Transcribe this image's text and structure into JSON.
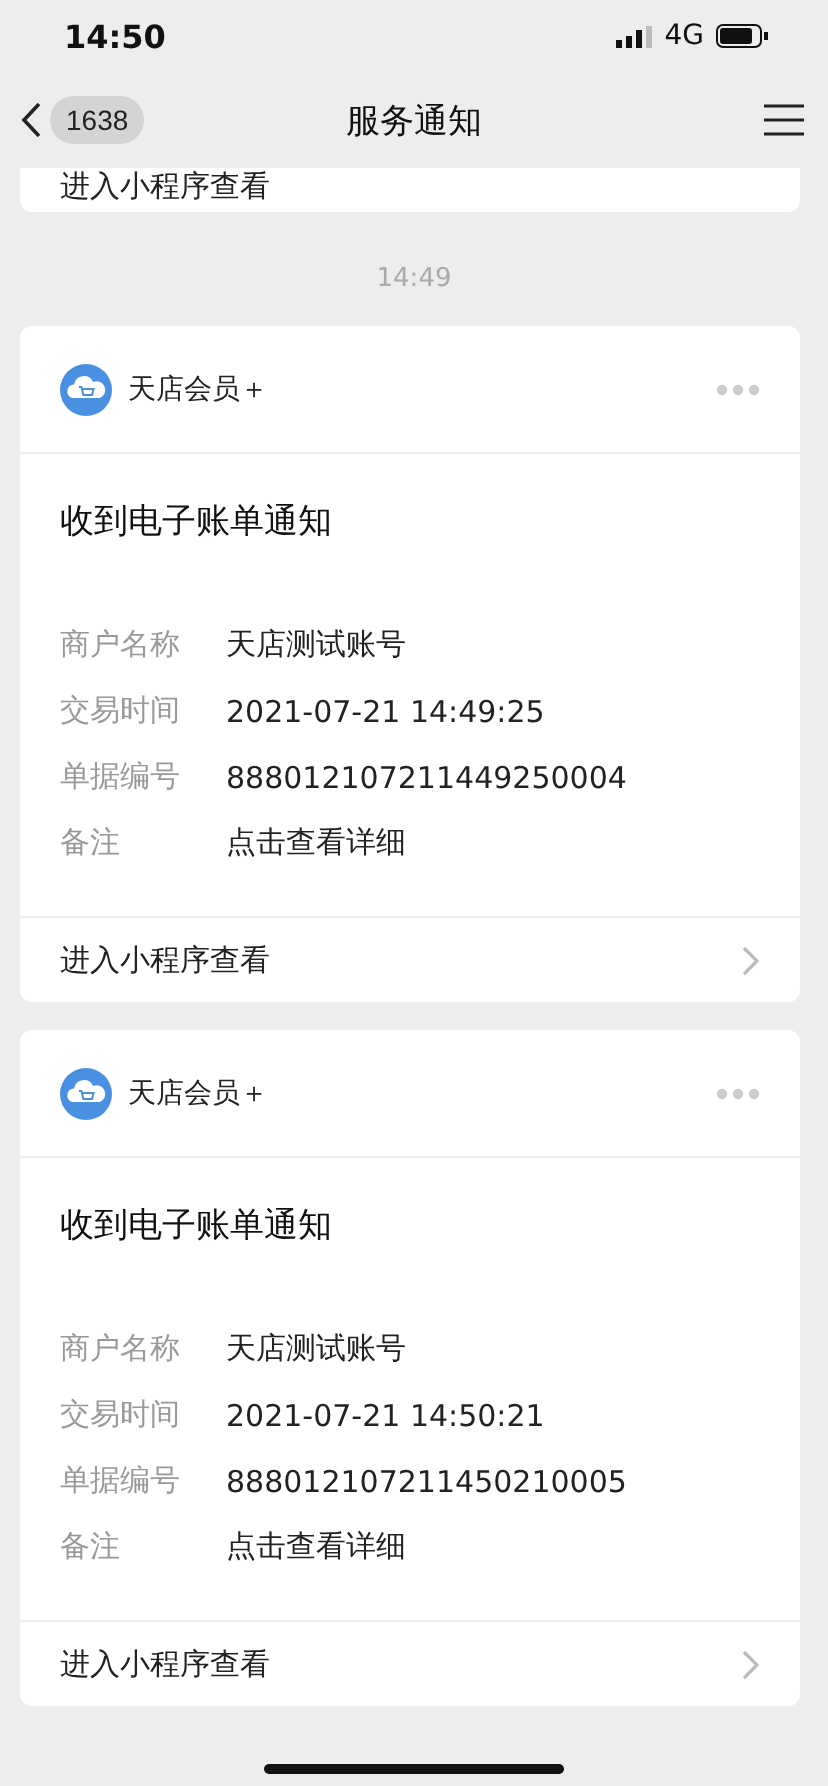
{
  "status_bar": {
    "time": "14:50",
    "network": "4G"
  },
  "nav": {
    "back_count": "1638",
    "title": "服务通知"
  },
  "previous_card": {
    "link": "进入小程序查看"
  },
  "timestamp": "14:49",
  "messages": [
    {
      "sender": "天店会员＋",
      "title": "收到电子账单通知",
      "fields": [
        {
          "label": "商户名称",
          "value": "天店测试账号"
        },
        {
          "label": "交易时间",
          "value": "2021-07-21 14:49:25"
        },
        {
          "label": "单据编号",
          "value": "888012107211449250004"
        },
        {
          "label": "备注",
          "value": "点击查看详细"
        }
      ],
      "link": "进入小程序查看"
    },
    {
      "sender": "天店会员＋",
      "title": "收到电子账单通知",
      "fields": [
        {
          "label": "商户名称",
          "value": "天店测试账号"
        },
        {
          "label": "交易时间",
          "value": "2021-07-21 14:50:21"
        },
        {
          "label": "单据编号",
          "value": "888012107211450210005"
        },
        {
          "label": "备注",
          "value": "点击查看详细"
        }
      ],
      "link": "进入小程序查看"
    }
  ]
}
